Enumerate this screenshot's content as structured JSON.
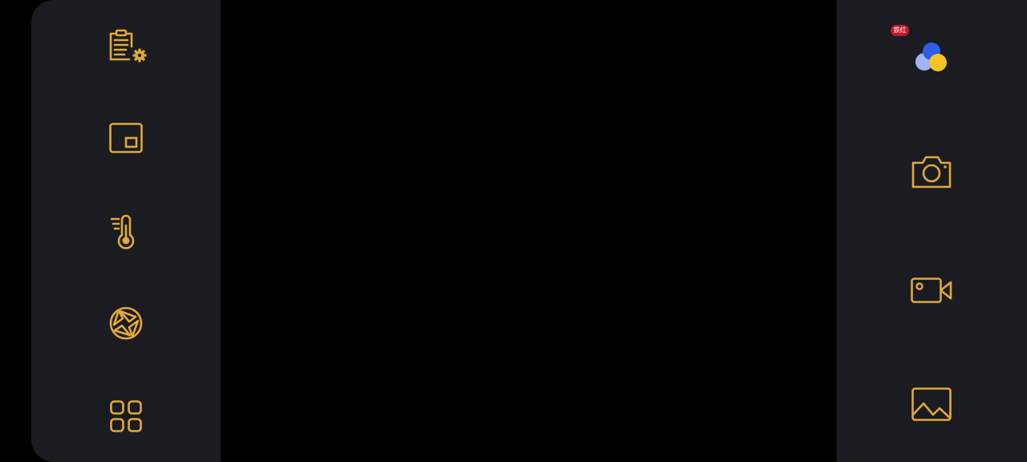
{
  "colors": {
    "accent": "#e0a93a",
    "panel": "#1b1c22",
    "viewfinder": "#000000",
    "badge": "#c0192f",
    "dots": [
      "#2f5de8",
      "#9fb3f5",
      "#f5c424"
    ]
  },
  "left_toolbar": {
    "items": [
      {
        "icon": "clipboard-settings-icon"
      },
      {
        "icon": "picture-in-picture-icon"
      },
      {
        "icon": "thermometer-icon"
      },
      {
        "icon": "aperture-icon"
      },
      {
        "icon": "grid-apps-icon"
      }
    ]
  },
  "right_toolbar": {
    "badge_text": "鉄红",
    "items": [
      {
        "icon": "assistant-dots-icon"
      },
      {
        "icon": "camera-icon"
      },
      {
        "icon": "video-camera-icon"
      },
      {
        "icon": "gallery-image-icon"
      }
    ]
  }
}
